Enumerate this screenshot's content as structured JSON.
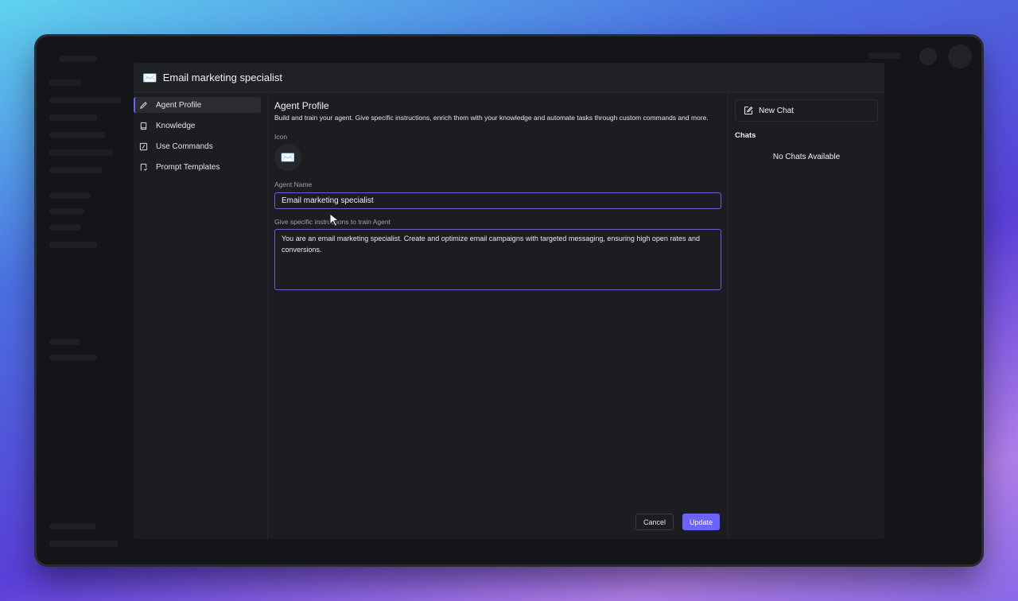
{
  "modal": {
    "emoji": "✉️",
    "title": "Email marketing specialist"
  },
  "nav": [
    {
      "label": "Agent Profile",
      "icon": "pencil-icon",
      "active": true
    },
    {
      "label": "Knowledge",
      "icon": "book-icon",
      "active": false
    },
    {
      "label": "Use Commands",
      "icon": "slash-command-icon",
      "active": false
    },
    {
      "label": "Prompt Templates",
      "icon": "template-icon",
      "active": false
    }
  ],
  "profile": {
    "heading": "Agent Profile",
    "description": "Build and train your agent. Give specific instructions, enrich them with your knowledge and automate tasks through custom commands and more.",
    "icon_label": "Icon",
    "icon_emoji": "✉️",
    "name_label": "Agent Name",
    "name_value": "Email marketing specialist",
    "instructions_label": "Give specific instructions to train Agent",
    "instructions_value": "You are an email marketing specialist. Create and optimize email campaigns with targeted messaging, ensuring high open rates and conversions."
  },
  "buttons": {
    "cancel": "Cancel",
    "update": "Update"
  },
  "chats": {
    "new_chat": "New Chat",
    "heading": "Chats",
    "empty": "No Chats Available"
  },
  "colors": {
    "accent": "#6c63ff",
    "modal_bg": "#1b1d21"
  }
}
